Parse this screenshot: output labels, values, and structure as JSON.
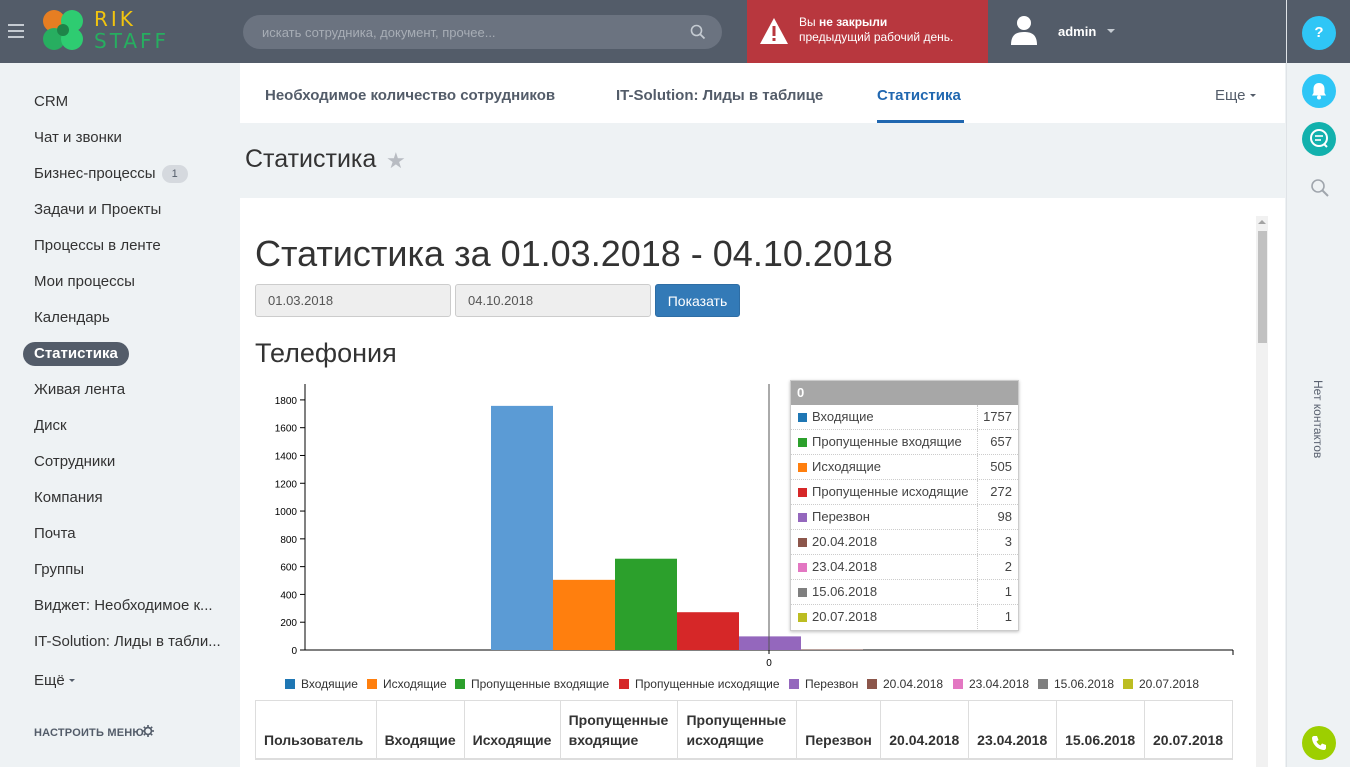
{
  "header": {
    "logo_top": "RIK",
    "logo_bottom": "STAFF",
    "search_placeholder": "искать сотрудника, документ, прочее...",
    "alert_line1_prefix": "Вы ",
    "alert_line1_bold": "не закрыли",
    "alert_line2": "предыдущий рабочий день.",
    "user_name": "admin",
    "help_label": "?"
  },
  "rightbar": {
    "contacts_label": "Нет контактов"
  },
  "sidebar": {
    "items": [
      {
        "label": "CRM"
      },
      {
        "label": "Чат и звонки"
      },
      {
        "label": "Бизнес-процессы",
        "badge": "1"
      },
      {
        "label": "Задачи и Проекты"
      },
      {
        "label": "Процессы в ленте"
      },
      {
        "label": "Мои процессы"
      },
      {
        "label": "Календарь"
      },
      {
        "label": "Статистика",
        "active": true
      },
      {
        "label": "Живая лента"
      },
      {
        "label": "Диск"
      },
      {
        "label": "Сотрудники"
      },
      {
        "label": "Компания"
      },
      {
        "label": "Почта"
      },
      {
        "label": "Группы"
      },
      {
        "label": "Виджет: Необходимое к..."
      },
      {
        "label": "IT-Solution: Лиды в табли..."
      },
      {
        "label": "Ещё"
      }
    ],
    "setup_label": "НАСТРОИТЬ МЕНЮ"
  },
  "tabs": {
    "items": [
      {
        "label": "Необходимое количество сотрудников"
      },
      {
        "label": "IT-Solution: Лиды в таблице"
      },
      {
        "label": "Статистика",
        "active": true
      }
    ],
    "more_label": "Еще"
  },
  "page": {
    "title": "Статистика",
    "star": "★",
    "heading": "Статистика за 01.03.2018 - 04.10.2018",
    "date_from": "01.03.2018",
    "date_to": "04.10.2018",
    "show_button": "Показать",
    "section_title": "Телефония"
  },
  "chart_data": {
    "type": "bar",
    "categories": [
      "0"
    ],
    "series": [
      {
        "name": "Входящие",
        "values": [
          1757
        ],
        "color": "#5b9bd5"
      },
      {
        "name": "Исходящие",
        "values": [
          505
        ],
        "color": "#ff7f0e"
      },
      {
        "name": "Пропущенные входящие",
        "values": [
          657
        ],
        "color": "#2ca02c"
      },
      {
        "name": "Пропущенные исходящие",
        "values": [
          272
        ],
        "color": "#d62728"
      },
      {
        "name": "Перезвон",
        "values": [
          98
        ],
        "color": "#9467bd"
      },
      {
        "name": "20.04.2018",
        "values": [
          3
        ],
        "color": "#8c564b"
      },
      {
        "name": "23.04.2018",
        "values": [
          2
        ],
        "color": "#e377c2"
      },
      {
        "name": "15.06.2018",
        "values": [
          1
        ],
        "color": "#7f7f7f"
      },
      {
        "name": "20.07.2018",
        "values": [
          1
        ],
        "color": "#bcbd22"
      }
    ],
    "yticks": [
      "0",
      "200",
      "400",
      "600",
      "800",
      "1000",
      "1200",
      "1400",
      "1600",
      "1800"
    ],
    "ylim": [
      0,
      1900
    ],
    "legend": "bottom"
  },
  "tooltip": {
    "title": "0",
    "rows": [
      {
        "name": "Входящие",
        "value": "1757",
        "color": "#1f77b4"
      },
      {
        "name": "Пропущенные входящие",
        "value": "657",
        "color": "#2ca02c"
      },
      {
        "name": "Исходящие",
        "value": "505",
        "color": "#ff7f0e"
      },
      {
        "name": "Пропущенные исходящие",
        "value": "272",
        "color": "#d62728"
      },
      {
        "name": "Перезвон",
        "value": "98",
        "color": "#9467bd"
      },
      {
        "name": "20.04.2018",
        "value": "3",
        "color": "#8c564b"
      },
      {
        "name": "23.04.2018",
        "value": "2",
        "color": "#e377c2"
      },
      {
        "name": "15.06.2018",
        "value": "1",
        "color": "#7f7f7f"
      },
      {
        "name": "20.07.2018",
        "value": "1",
        "color": "#bcbd22"
      }
    ]
  },
  "legend": [
    {
      "name": "Входящие",
      "color": "#1f77b4"
    },
    {
      "name": "Исходящие",
      "color": "#ff7f0e"
    },
    {
      "name": "Пропущенные входящие",
      "color": "#2ca02c"
    },
    {
      "name": "Пропущенные исходящие",
      "color": "#d62728"
    },
    {
      "name": "Перезвон",
      "color": "#9467bd"
    },
    {
      "name": "20.04.2018",
      "color": "#8c564b"
    },
    {
      "name": "23.04.2018",
      "color": "#e377c2"
    },
    {
      "name": "15.06.2018",
      "color": "#7f7f7f"
    },
    {
      "name": "20.07.2018",
      "color": "#bcbd22"
    }
  ],
  "table": {
    "headers": [
      "Пользователь",
      "Входящие",
      "Исходящие",
      "Пропущенные входящие",
      "Пропущенные исходящие",
      "Перезвон",
      "20.04.2018",
      "23.04.2018",
      "15.06.2018",
      "20.07.2018"
    ]
  }
}
